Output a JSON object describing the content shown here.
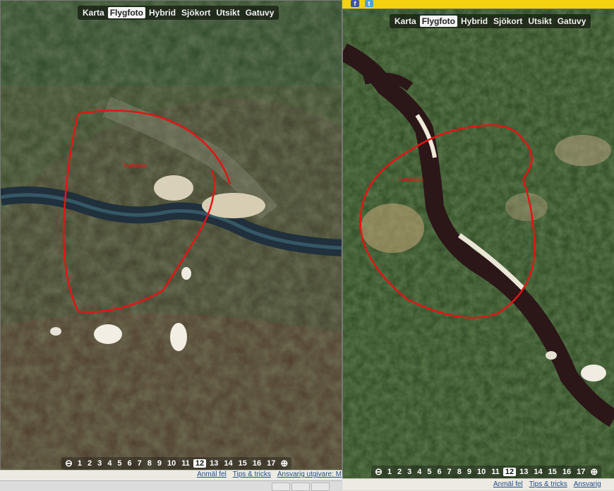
{
  "map_types": [
    "Karta",
    "Flygfoto",
    "Hybrid",
    "Sjökort",
    "Utsikt",
    "Gatuvy"
  ],
  "active_map_type": "Flygfoto",
  "zoom_levels": [
    "1",
    "2",
    "3",
    "4",
    "5",
    "6",
    "7",
    "8",
    "9",
    "10",
    "11",
    "12",
    "13",
    "14",
    "15",
    "16",
    "17"
  ],
  "active_zoom": "12",
  "footer_links": [
    "Anmäl fel",
    "Tips & tricks",
    "Ansvarig utgivare: M"
  ],
  "footer_links_right": [
    "Anmäl fel",
    "Tips & tricks",
    "Ansvarig"
  ],
  "social": {
    "facebook": "f",
    "twitter": "t"
  },
  "left_panel": {
    "place_label": "Haldimo"
  },
  "right_panel": {
    "place_label": "Lidelinde"
  },
  "colors": {
    "annotation": "#e31515",
    "topbar": "#f4d20f",
    "link": "#1e4c8a"
  }
}
